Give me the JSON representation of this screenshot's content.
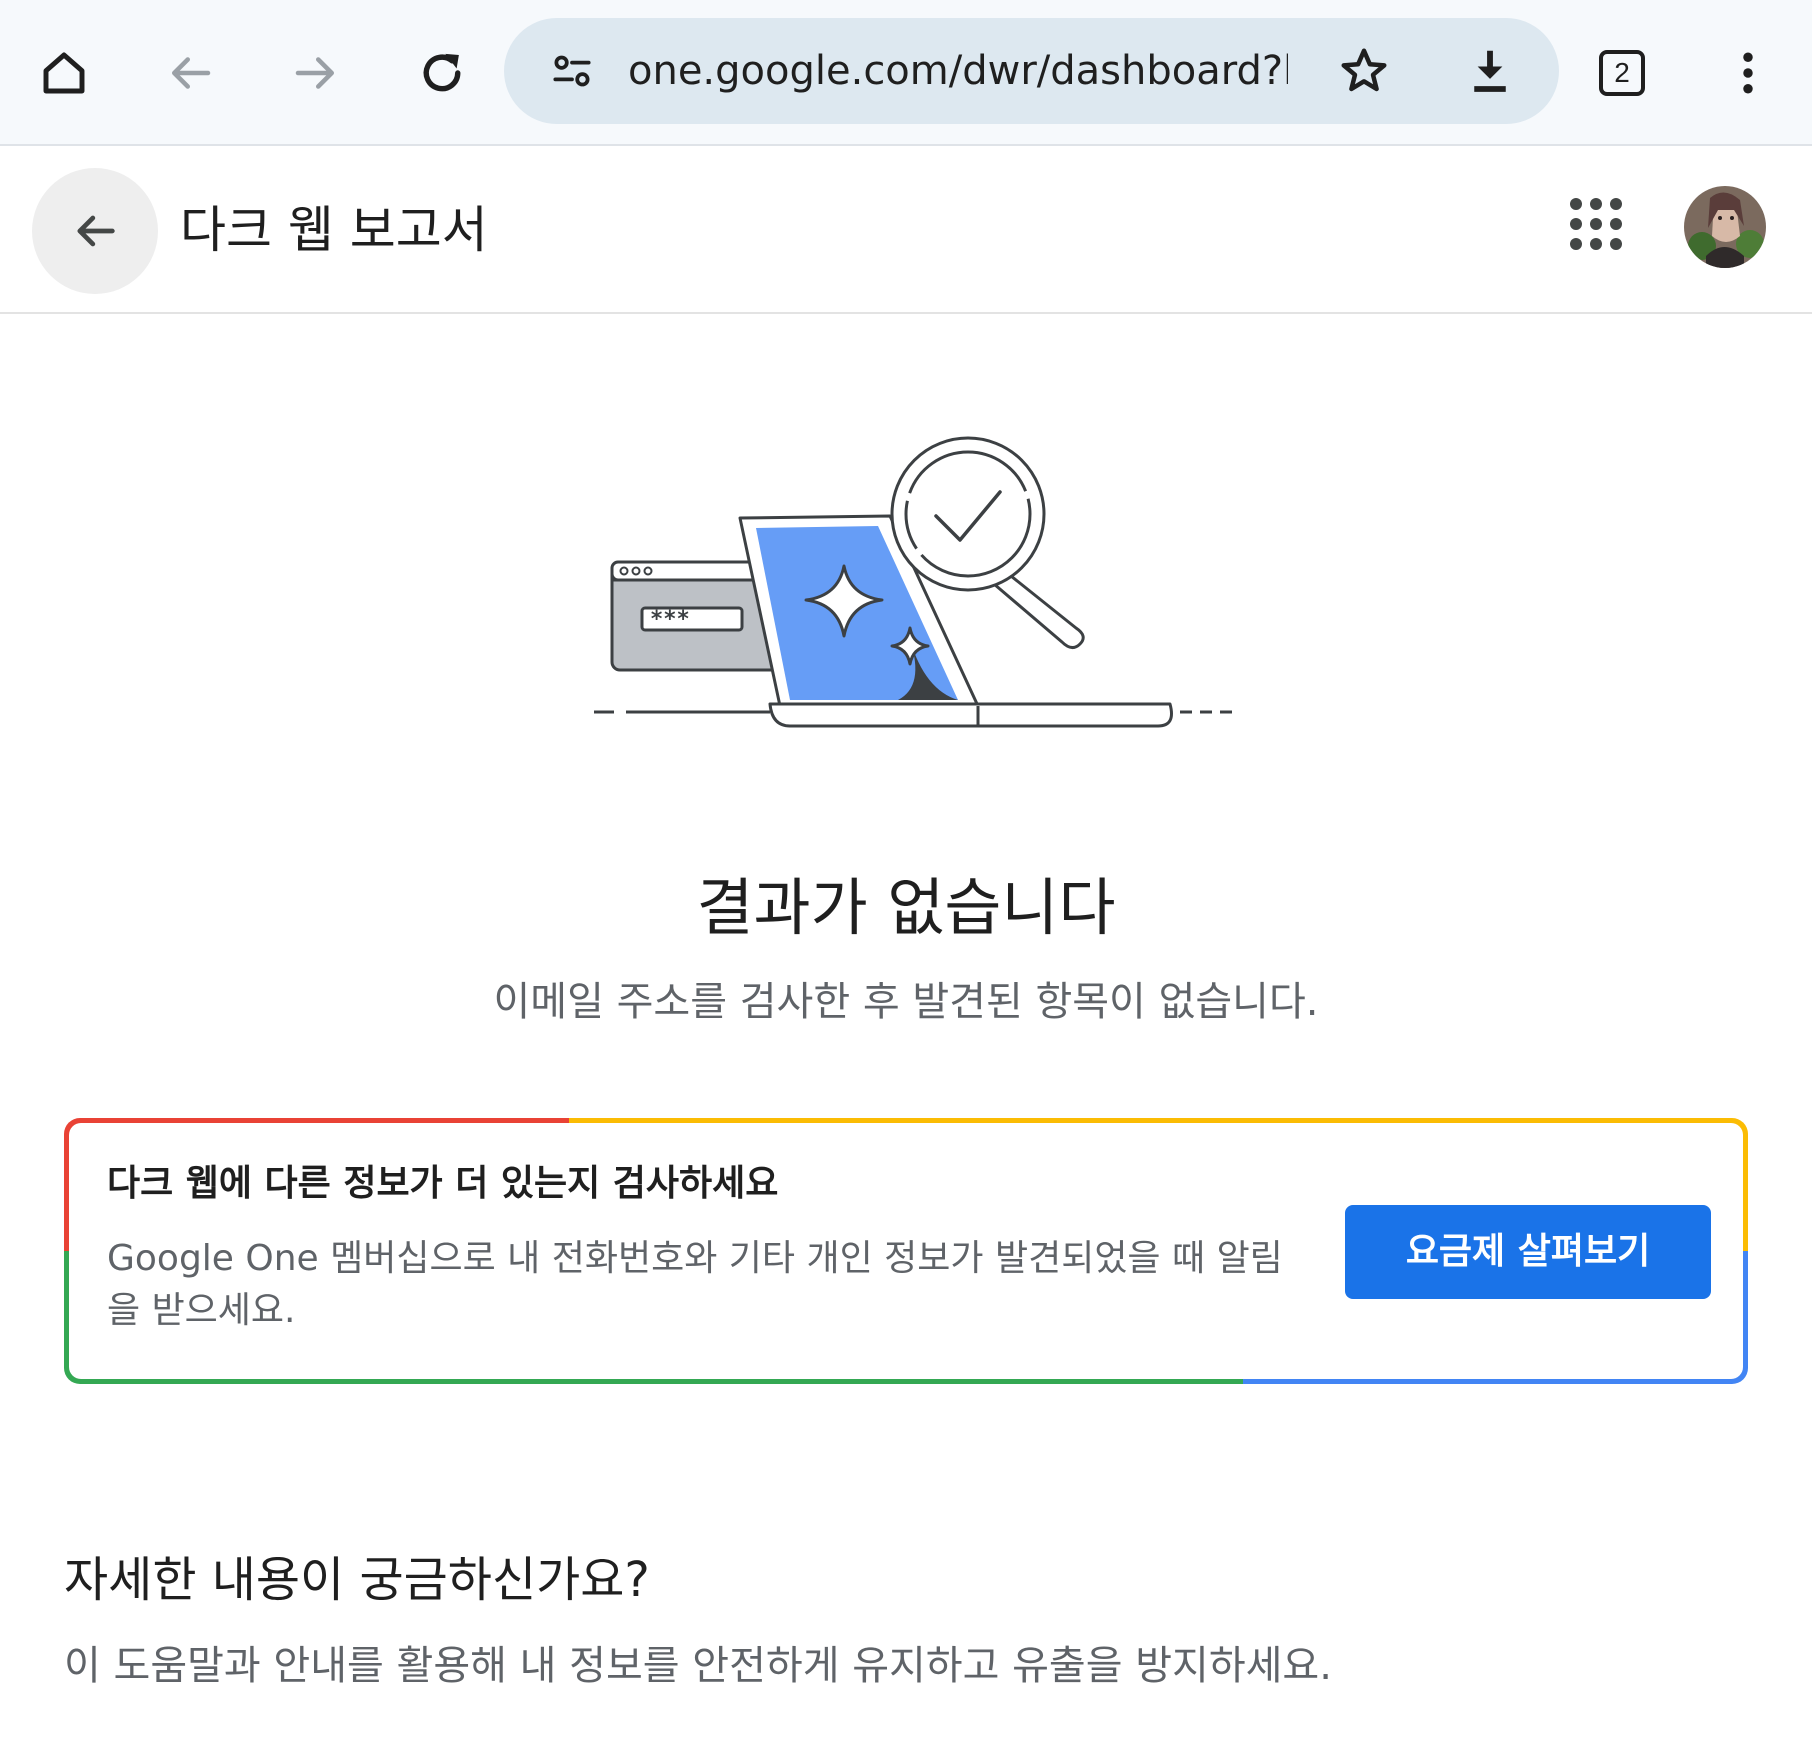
{
  "browser": {
    "url": "one.google.com/dwr/dashboard?hl=",
    "tab_count": "2",
    "icons": [
      "home-icon",
      "back-arrow-icon",
      "forward-arrow-icon",
      "reload-icon",
      "site-settings-icon",
      "bookmark-star-icon",
      "download-icon",
      "tab-switcher-icon",
      "overflow-menu-icon"
    ]
  },
  "header": {
    "title": "다크 웹 보고서",
    "icons": [
      "back-arrow-icon",
      "apps-grid-icon",
      "avatar"
    ]
  },
  "result": {
    "title": "결과가 없습니다",
    "subtitle": "이메일 주소를 검사한 후 발견된 항목이 없습니다."
  },
  "promo": {
    "title": "다크 웹에 다른 정보가 더 있는지 검사하세요",
    "description": "Google One 멤버십으로 내 전화번호와 기타 개인 정보가 발견되었을 때 알림을 받으세요.",
    "button_label": "요금제 살펴보기",
    "colors": {
      "red": "#e94235",
      "yellow": "#fbbc04",
      "green": "#34a853",
      "blue": "#4285f4",
      "button": "#1a73e8"
    }
  },
  "learn_more": {
    "title": "자세한 내용이 궁금하신가요?",
    "description": "이 도움말과 안내를 활용해 내 정보를 안전하게 유지하고 유출을 방지하세요."
  },
  "illustration": {
    "password_mask": "***"
  }
}
